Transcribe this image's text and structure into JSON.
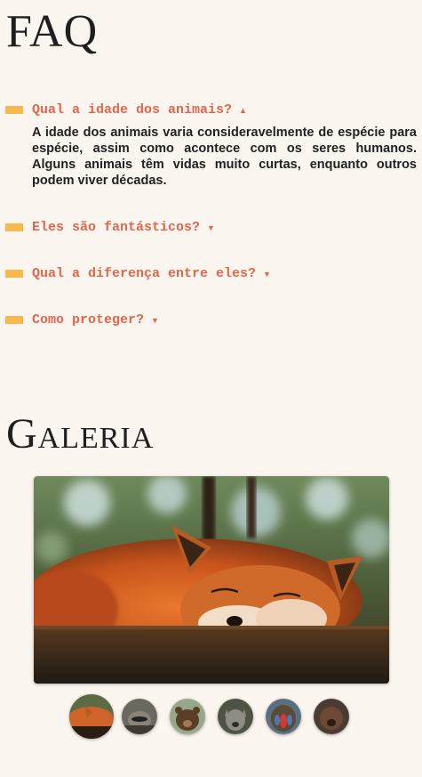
{
  "faq": {
    "title": "FAQ",
    "items": [
      {
        "question": "Qual a idade dos animais?",
        "expanded": true,
        "arrow": "▲",
        "answer": "A idade dos animais varia consideravelmente de espécie para espécie, assim como acontece com os seres humanos. Alguns animais têm vidas muito curtas, enquanto outros podem viver décadas."
      },
      {
        "question": "Eles são fantásticos?",
        "expanded": false,
        "arrow": "▼"
      },
      {
        "question": "Qual a diferença entre eles?",
        "expanded": false,
        "arrow": "▼"
      },
      {
        "question": "Como proteger?",
        "expanded": false,
        "arrow": "▼"
      }
    ]
  },
  "gallery": {
    "title": "Galeria",
    "thumbnails": [
      {
        "subject": "fox",
        "active": true
      },
      {
        "subject": "raccoon",
        "active": false
      },
      {
        "subject": "bear",
        "active": false
      },
      {
        "subject": "wolf",
        "active": false
      },
      {
        "subject": "mandrill",
        "active": false
      },
      {
        "subject": "dark-animal",
        "active": false
      }
    ]
  },
  "colors": {
    "background": "#faf5ee",
    "accent_bar": "#f7b84e",
    "question_text": "#e2664b",
    "body_text": "#222222"
  }
}
